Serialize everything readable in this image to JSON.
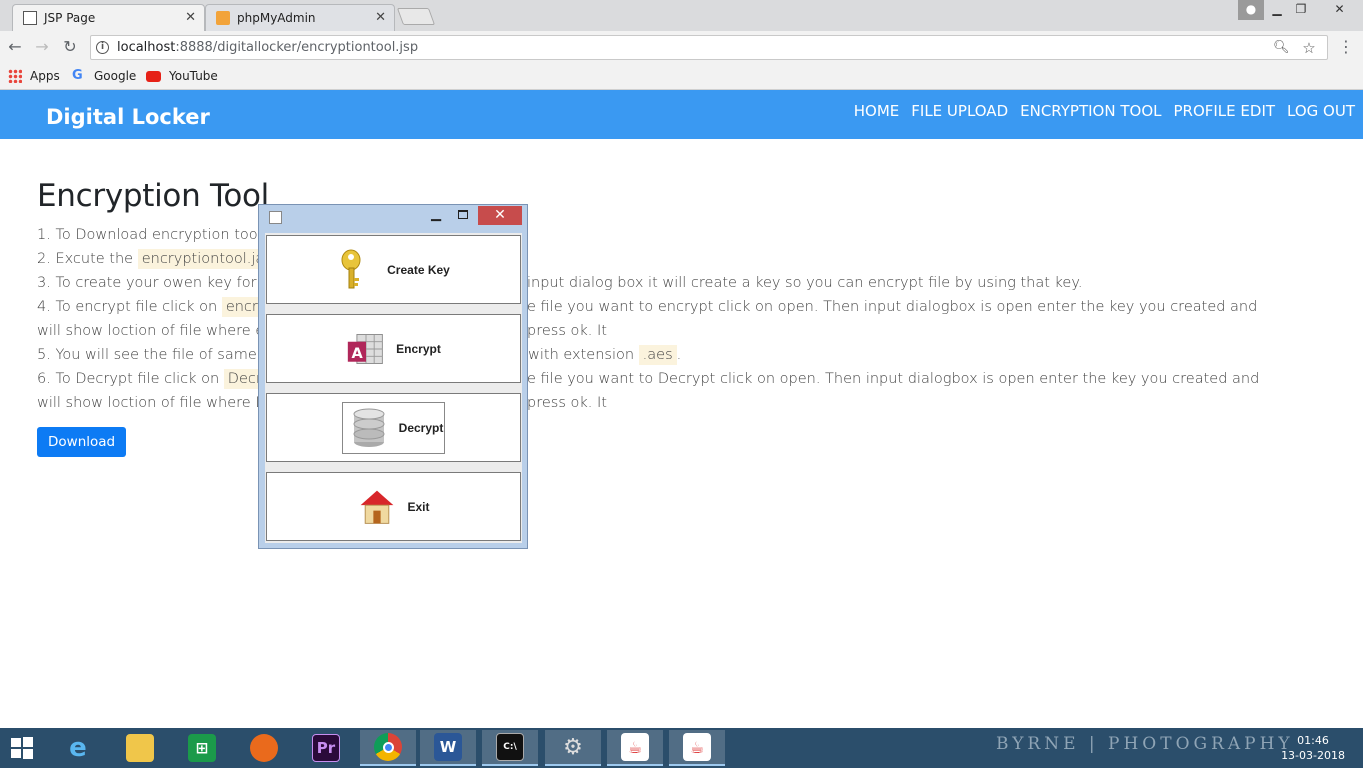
{
  "browser": {
    "tabs": [
      {
        "label": "JSP Page",
        "active": true
      },
      {
        "label": "phpMyAdmin",
        "active": false
      }
    ],
    "address": {
      "host": "localhost",
      "rest": ":8888/digitallocker/encryptiontool.jsp"
    },
    "bookmarks": [
      "Apps",
      "Google",
      "YouTube"
    ]
  },
  "site": {
    "brand": "Digital Locker",
    "nav": [
      "HOME",
      "FILE UPLOAD",
      "ENCRYPTION TOOL",
      "PROFILE EDIT",
      "LOG OUT"
    ]
  },
  "content": {
    "title": "Encryption Tool",
    "steps": {
      "s1": "1. To Download encryption tool cl",
      "s2a": "2. Excute the ",
      "s2chip": "encryptiontool.jar",
      "s2b": " f",
      "s3a": "3. To create your owen key for en",
      "s3b": "input dialog box it will create a key so you can encrypt file by using that key.",
      "s4a": "4. To encrypt file click on ",
      "s4chip": "encrypt",
      "s4b": "e file you want to encrypt click on open. Then input dialogbox is open enter the key you created and press ok. It",
      "s4c": "will show loction of file where enc",
      "s5a": "5. You will see the file of same na",
      "s5b": "with extension ",
      "s5chip": ".aes",
      "s5c": ".",
      "s6a": "6. To Decrypt file click on ",
      "s6chip": "Decryp",
      "s6b": "e file you want to Decrypt click on open. Then input dialogbox is open enter the key you created and press ok. It",
      "s6c": "will show loction of file where Dec"
    },
    "download_label": "Download"
  },
  "dialog": {
    "buttons": {
      "create_key": "Create Key",
      "encrypt": "Encrypt",
      "decrypt": "Decrypt",
      "exit": "Exit"
    }
  },
  "taskbar": {
    "watermark": "BYRNE | PHOTOGRAPHY",
    "time": "01:46",
    "date": "13-03-2018",
    "colors": {
      "bar": "#2b4e6b",
      "accent": "#3a99f2"
    }
  }
}
